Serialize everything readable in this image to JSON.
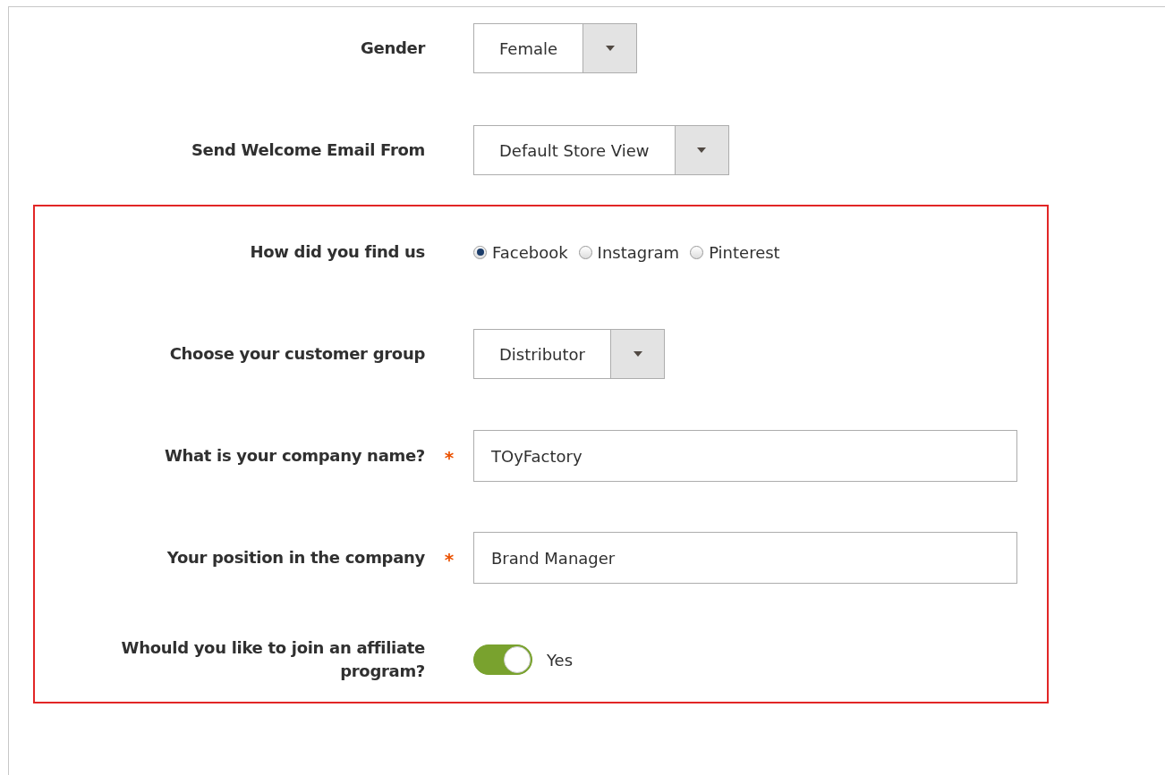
{
  "sections": [
    {
      "highlighted": false,
      "fields": [
        {
          "kind": "select",
          "label": "Gender",
          "value": "Female"
        },
        {
          "kind": "select",
          "label": "Send Welcome Email From",
          "value": "Default Store View"
        }
      ]
    },
    {
      "highlighted": true,
      "fields": [
        {
          "kind": "radio",
          "label": "How did you find us",
          "options": [
            {
              "label": "Facebook",
              "selected": true
            },
            {
              "label": "Instagram",
              "selected": false
            },
            {
              "label": "Pinterest",
              "selected": false
            }
          ]
        },
        {
          "kind": "select",
          "label": "Choose your customer group",
          "value": "Distributor"
        },
        {
          "kind": "text",
          "label": "What is your company name?",
          "required_mark": "*",
          "value": "TOyFactory"
        },
        {
          "kind": "text",
          "label": "Your position in the company",
          "required_mark": "*",
          "value": "Brand Manager"
        },
        {
          "kind": "toggle",
          "label": "Whould you like to join an affiliate program?",
          "on": true,
          "state_label": "Yes"
        }
      ]
    }
  ]
}
